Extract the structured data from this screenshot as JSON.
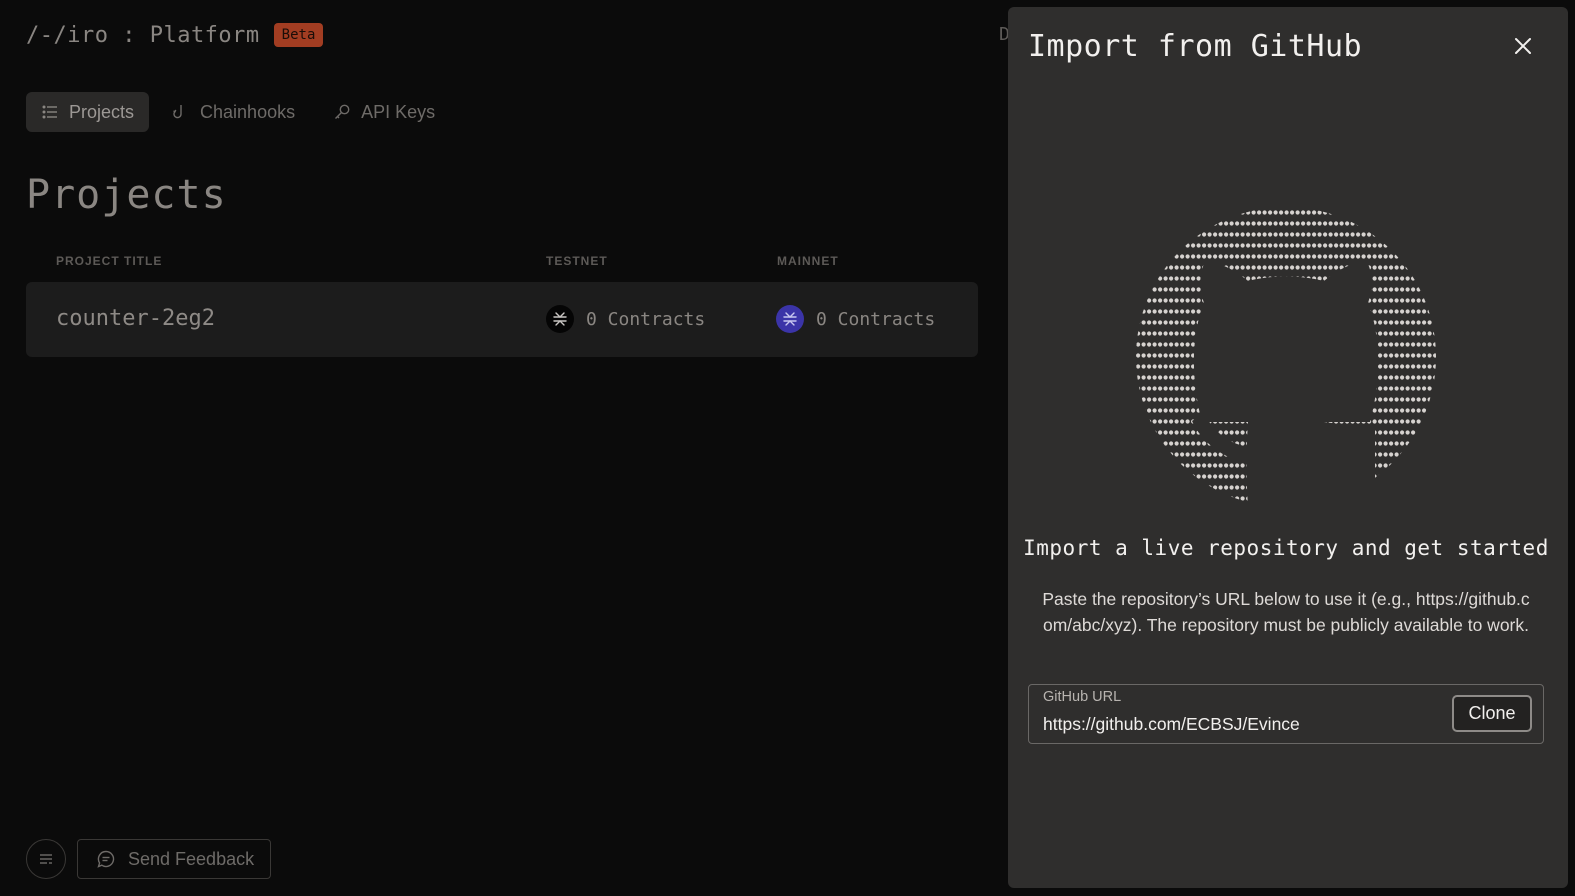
{
  "app": {
    "brand": "/-/iro : Platform",
    "beta_badge": "Beta",
    "peek_char": "D"
  },
  "nav": {
    "items": [
      {
        "label": "Projects",
        "icon": "list-icon",
        "active": true
      },
      {
        "label": "Chainhooks",
        "icon": "hook-icon",
        "active": false
      },
      {
        "label": "API Keys",
        "icon": "key-icon",
        "active": false
      }
    ]
  },
  "page": {
    "title": "Projects",
    "columns": {
      "title": "PROJECT TITLE",
      "testnet": "TESTNET",
      "mainnet": "MAINNET"
    },
    "projects": [
      {
        "title": "counter-2eg2",
        "testnet": "0 Contracts",
        "mainnet": "0 Contracts"
      }
    ]
  },
  "footer": {
    "menu_icon": "menu-icon",
    "feedback_label": "Send Feedback",
    "feedback_icon": "chat-bubble-icon"
  },
  "drawer": {
    "title": "Import from GitHub",
    "close_icon": "close-icon",
    "art_icon": "github-ascii-logo",
    "heading": "Import a live repository and get started",
    "description": "Paste the repository’s URL below to use it (e.g., https://github.c om/abc/xyz). The repository must be publicly available to work.",
    "url_label": "GitHub URL",
    "url_value": "https://github.com/ECBSJ/Evince",
    "clone_label": "Clone"
  },
  "colors": {
    "background": "#0b0b0b",
    "drawer": "#2f2e2d",
    "beta": "#a23d22",
    "mainnet": "#3b34a8"
  }
}
